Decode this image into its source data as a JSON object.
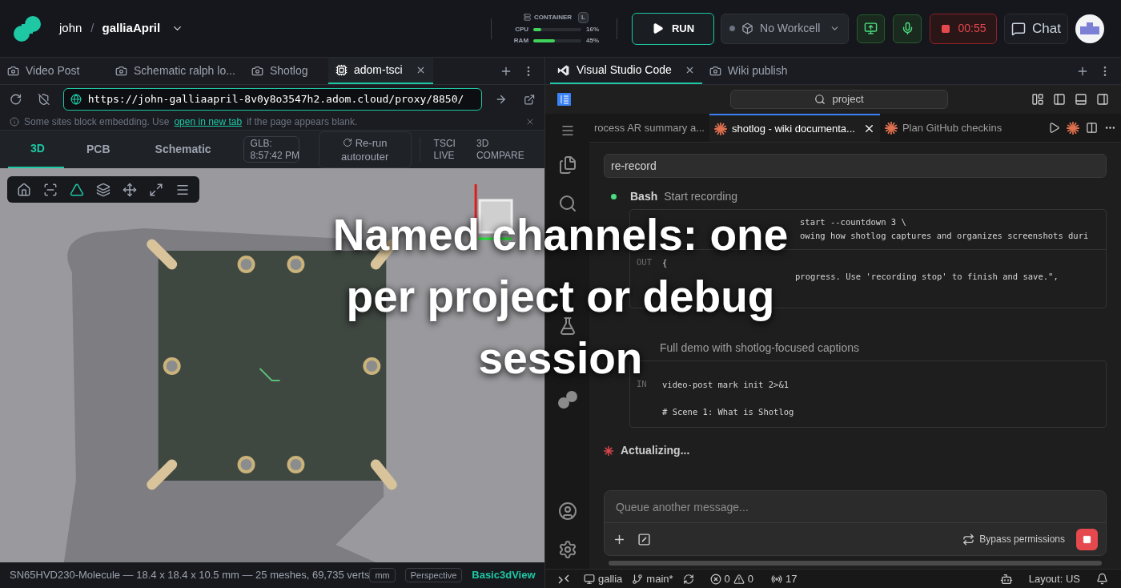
{
  "topbar": {
    "user": "john",
    "separator": "/",
    "project": "galliaApril",
    "container": {
      "label": "CONTAINER",
      "size": "L",
      "meters": [
        {
          "name": "CPU",
          "level": 0.16,
          "reading": "16%"
        },
        {
          "name": "RAM",
          "level": 0.45,
          "reading": "45%"
        }
      ]
    },
    "run": "RUN",
    "workcell": "No Workcell",
    "recording": {
      "on": true,
      "time": "00:55"
    },
    "chat": "Chat"
  },
  "left": {
    "tabs": [
      {
        "label": "Video Post",
        "kind": "capture",
        "selected": false
      },
      {
        "label": "Schematic ralph lo...",
        "kind": "capture",
        "selected": false
      },
      {
        "label": "Shotlog",
        "kind": "capture",
        "selected": false
      },
      {
        "label": "adom-tsci",
        "kind": "chip",
        "selected": true
      }
    ],
    "url": "https://john-galliaapril-8v0y8o3547h2.adom.cloud/proxy/8850/",
    "notice": {
      "before": "Some sites block embedding. Use",
      "link": "open in new tab",
      "after": "if the page appears blank."
    },
    "views": [
      {
        "label": "3D",
        "selected": true
      },
      {
        "label": "PCB",
        "selected": false
      },
      {
        "label": "Schematic",
        "selected": false
      }
    ],
    "glb": {
      "label": "GLB:",
      "time": "8:57:42 PM"
    },
    "rerun": {
      "line1": "Re-run",
      "line2": "autorouter"
    },
    "links": [
      {
        "line1": "TSCI",
        "line2": "LIVE"
      },
      {
        "line1": "3D",
        "line2": "COMPARE"
      }
    ],
    "tools": [
      {
        "kind": "home",
        "selected": false
      },
      {
        "kind": "frame",
        "selected": false
      },
      {
        "kind": "triangle",
        "selected": true
      },
      {
        "kind": "layers",
        "selected": false
      },
      {
        "kind": "move",
        "selected": false
      },
      {
        "kind": "expand",
        "selected": false
      },
      {
        "kind": "menu",
        "selected": false
      }
    ],
    "footer": {
      "info": "SN65HVD230-Molecule — 18.4 x 18.4 x 10.5 mm — 25 meshes, 69,735 verts",
      "unit": "mm",
      "projection": "Perspective",
      "view": "Basic3dView"
    }
  },
  "right": {
    "tabs": [
      {
        "label": "Visual Studio Code",
        "kind": "vscode",
        "selected": true
      },
      {
        "label": "Wiki publish",
        "kind": "capture",
        "selected": false
      }
    ],
    "search": "project",
    "editor_tabs": [
      {
        "label": "rocess AR summary a...",
        "kind": "plain",
        "selected": false
      },
      {
        "label": "shotlog - wiki documenta...",
        "kind": "star",
        "selected": true
      },
      {
        "label": "Plan GitHub checkins",
        "kind": "star",
        "selected": false
      }
    ],
    "prompt": "re-record",
    "steps": [
      {
        "tool": "Bash",
        "title": "Start recording",
        "dot": true,
        "blocks": [
          {
            "kind": "command",
            "lines": [
              "start --countdown 3 \\",
              "owing how shotlog captures and organizes screenshots duri"
            ]
          },
          {
            "kind": "output",
            "tag": "OUT",
            "lines": [
              "{",
              "progress. Use 'recording stop' to finish and save.\","
            ]
          }
        ]
      },
      {
        "title": "Full demo with shotlog-focused captions",
        "blocks": [
          {
            "kind": "input",
            "tag": "IN",
            "lines": [
              "video-post mark init 2>&1",
              "# Scene 1: What is Shotlog"
            ]
          }
        ]
      }
    ],
    "status_text": "Actualizing...",
    "composer": {
      "placeholder": "Queue another message...",
      "mode": "Bypass permissions"
    },
    "statusbar": {
      "host": "gallia",
      "branch": "main*",
      "errors": "0",
      "warnings": "0",
      "ports": "17",
      "layout": "Layout: US"
    }
  },
  "caption": [
    "Named channels: one",
    "per project or debug",
    "session"
  ]
}
